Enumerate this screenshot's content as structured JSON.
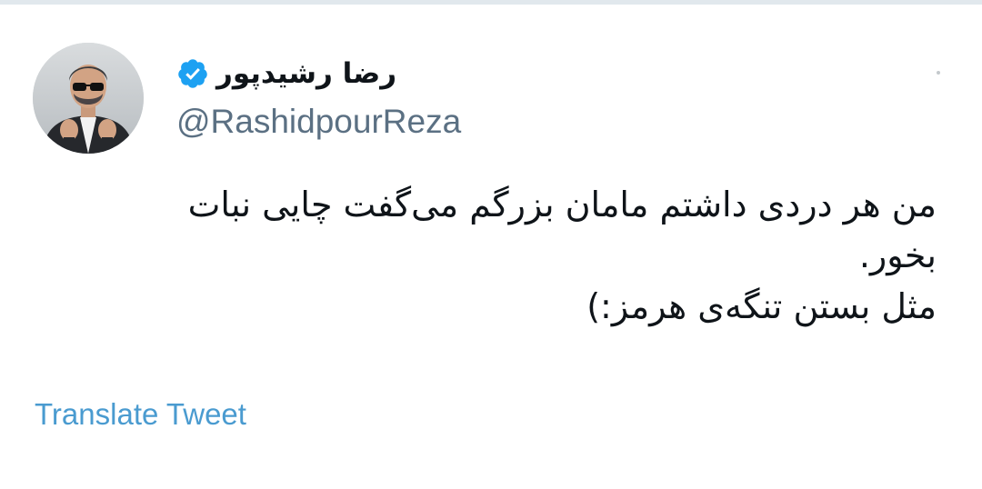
{
  "tweet": {
    "author": {
      "display_name": "رضا رشیدپور",
      "handle": "@RashidpourReza",
      "verified": true,
      "verified_icon": "verified-badge-icon",
      "avatar_icon": "avatar"
    },
    "text_lines": [
      "من هر دردی داشتم مامان بزرگم می‌گفت چایی نبات",
      "بخور.",
      "مثل بستن تنگه‌ی هرمز:)"
    ],
    "translate_label": "Translate Tweet"
  },
  "colors": {
    "background": "#ffffff",
    "text": "#0f1419",
    "secondary_text": "#5b7083",
    "link": "#4a9bd0",
    "verified": "#1da1f2"
  }
}
